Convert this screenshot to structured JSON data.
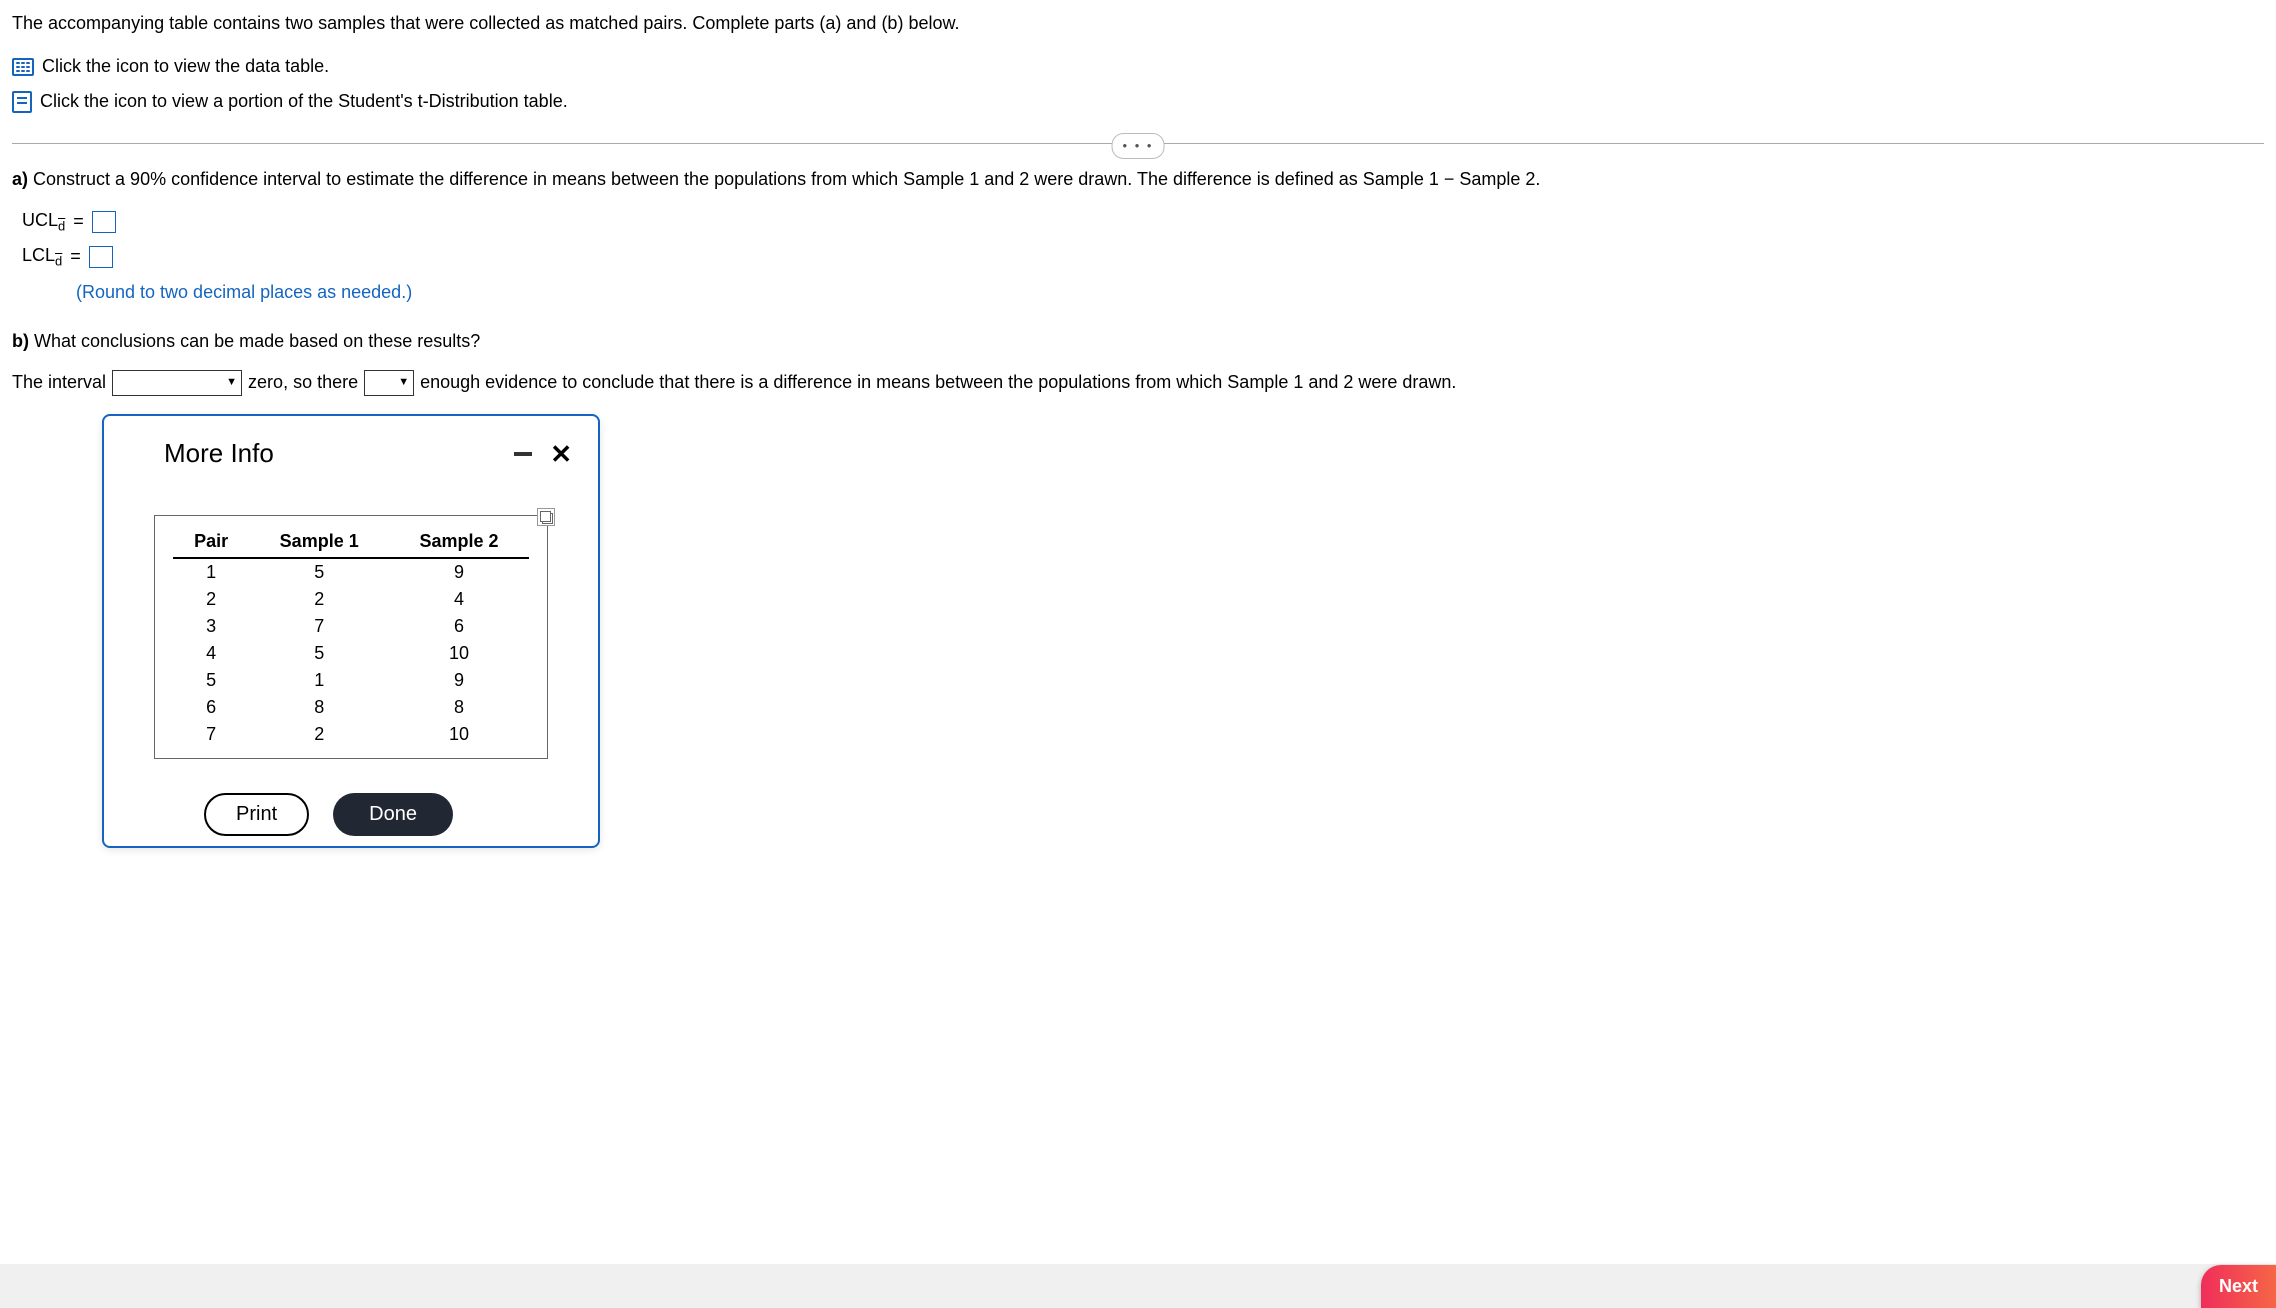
{
  "header": {
    "intro": "The accompanying table contains two samples that were collected as matched pairs. Complete parts (a) and (b) below.",
    "link_data": "Click the icon to view the data table.",
    "link_tdist": "Click the icon to view a portion of the Student's t-Distribution table."
  },
  "dots": "• • •",
  "partA": {
    "label": "a)",
    "text": " Construct a 90% confidence interval to estimate the difference in means between the populations from which Sample 1 and 2 were drawn. The difference is defined as Sample 1 − Sample 2.",
    "ucl_label": "UCL",
    "lcl_label": "LCL",
    "sub": "d̄",
    "equals": "=",
    "hint": "(Round to two decimal places as needed.)"
  },
  "partB": {
    "label": "b)",
    "text": " What conclusions can be made based on these results?",
    "pre": "The interval",
    "mid": "zero, so there",
    "post": "enough evidence to conclude that there is a difference in means between the populations from which Sample 1 and 2 were drawn."
  },
  "modal": {
    "title": "More Info",
    "table": {
      "headers": [
        "Pair",
        "Sample 1",
        "Sample 2"
      ],
      "rows": [
        [
          "1",
          "5",
          "9"
        ],
        [
          "2",
          "2",
          "4"
        ],
        [
          "3",
          "7",
          "6"
        ],
        [
          "4",
          "5",
          "10"
        ],
        [
          "5",
          "1",
          "9"
        ],
        [
          "6",
          "8",
          "8"
        ],
        [
          "7",
          "2",
          "10"
        ]
      ]
    },
    "print": "Print",
    "done": "Done"
  },
  "next": "Next"
}
